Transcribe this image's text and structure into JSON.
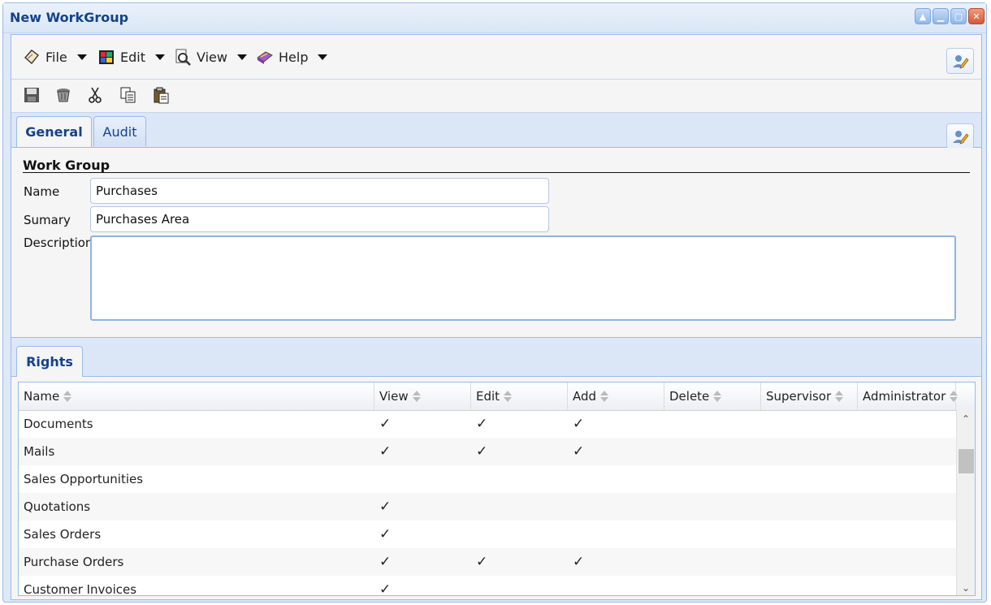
{
  "window": {
    "title": "New WorkGroup"
  },
  "menu": [
    {
      "label": "File",
      "icon": "file-icon"
    },
    {
      "label": "Edit",
      "icon": "edit-icon"
    },
    {
      "label": "View",
      "icon": "view-icon"
    },
    {
      "label": "Help",
      "icon": "help-icon"
    }
  ],
  "toolbar": [
    "save-icon",
    "delete-icon",
    "cut-icon",
    "copy-icon",
    "paste-icon"
  ],
  "tabs": {
    "general": "General",
    "audit": "Audit",
    "rights": "Rights"
  },
  "form": {
    "section_title": "Work Group",
    "name_label": "Name",
    "name_value": "Purchases",
    "summary_label": "Sumary",
    "summary_value": "Purchases Area",
    "description_label": "Description",
    "description_value": ""
  },
  "rights": {
    "columns": [
      "Name",
      "View",
      "Edit",
      "Add",
      "Delete",
      "Supervisor",
      "Administrator"
    ],
    "check_glyph": "✓",
    "rows": [
      {
        "name": "Documents",
        "view": true,
        "edit": true,
        "add": true,
        "delete": false,
        "supervisor": false,
        "administrator": false
      },
      {
        "name": "Mails",
        "view": true,
        "edit": true,
        "add": true,
        "delete": false,
        "supervisor": false,
        "administrator": false
      },
      {
        "name": "Sales Opportunities",
        "view": false,
        "edit": false,
        "add": false,
        "delete": false,
        "supervisor": false,
        "administrator": false
      },
      {
        "name": "Quotations",
        "view": true,
        "edit": false,
        "add": false,
        "delete": false,
        "supervisor": false,
        "administrator": false
      },
      {
        "name": "Sales Orders",
        "view": true,
        "edit": false,
        "add": false,
        "delete": false,
        "supervisor": false,
        "administrator": false
      },
      {
        "name": "Purchase Orders",
        "view": true,
        "edit": true,
        "add": true,
        "delete": false,
        "supervisor": false,
        "administrator": false
      },
      {
        "name": "Customer Invoices",
        "view": true,
        "edit": false,
        "add": false,
        "delete": false,
        "supervisor": false,
        "administrator": false
      }
    ]
  },
  "colors": {
    "accent": "#15428b",
    "border": "#99bbe8",
    "panel": "#dfe8f6"
  }
}
